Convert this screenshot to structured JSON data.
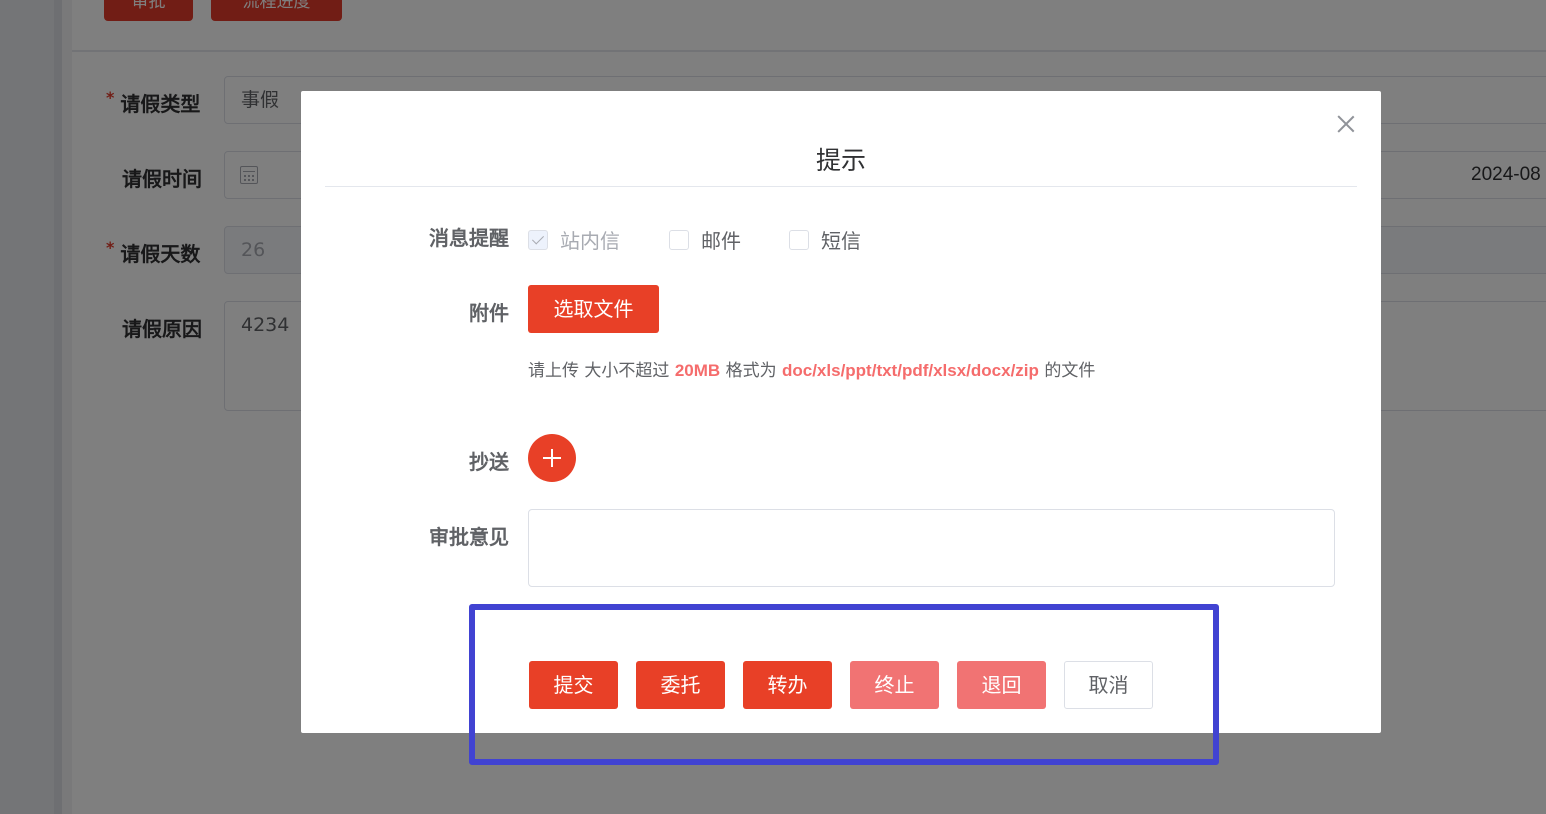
{
  "background": {
    "top_buttons": [
      "审批",
      "流程进度"
    ],
    "fields": [
      {
        "label": "请假类型",
        "value": "事假",
        "required": true
      },
      {
        "label": "请假时间",
        "value": "2024-08",
        "required": false
      },
      {
        "label": "请假天数",
        "value": "26",
        "required": true
      },
      {
        "label": "请假原因",
        "value": "4234",
        "required": false
      }
    ],
    "required_mark": "*"
  },
  "dialog": {
    "title": "提示",
    "notify": {
      "label": "消息提醒",
      "options": [
        {
          "label": "站内信",
          "checked": true,
          "disabled": true
        },
        {
          "label": "邮件",
          "checked": false,
          "disabled": false
        },
        {
          "label": "短信",
          "checked": false,
          "disabled": false
        }
      ]
    },
    "attachment": {
      "label": "附件",
      "button_label": "选取文件",
      "hint_prefix": "请上传 大小不超过 ",
      "hint_size": "20MB",
      "hint_mid": " 格式为 ",
      "hint_formats": "doc/xls/ppt/txt/pdf/xlsx/docx/zip",
      "hint_suffix": " 的文件"
    },
    "cc": {
      "label": "抄送"
    },
    "opinion": {
      "label": "审批意见",
      "value": ""
    },
    "actions": {
      "submit": "提交",
      "delegate": "委托",
      "transfer": "转办",
      "terminate": "终止",
      "return": "退回",
      "cancel": "取消"
    }
  },
  "colors": {
    "primary": "#e84027",
    "light": "#f17373",
    "highlight": "#4143d2",
    "hint_emphasis": "#f56c6c"
  }
}
